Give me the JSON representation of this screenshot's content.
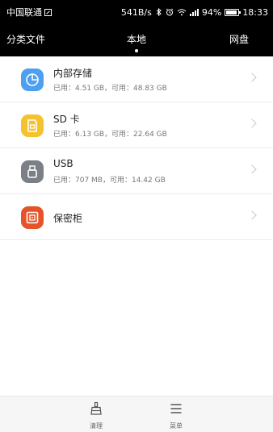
{
  "status_bar": {
    "carrier": "中国联通",
    "speed": "541B/s",
    "battery_percent": "94%",
    "time": "18:33"
  },
  "tabs": {
    "left": "分类文件",
    "center": "本地",
    "right": "网盘",
    "active": "本地"
  },
  "storage_items": [
    {
      "title": "内部存储",
      "sub": "已用：4.51 GB，可用：48.83 GB",
      "icon": "pie-chart-icon",
      "color": "#4e9ff0"
    },
    {
      "title": "SD 卡",
      "sub": "已用：6.13 GB，可用：22.64 GB",
      "icon": "sd-card-icon",
      "color": "#f5c22f"
    },
    {
      "title": "USB",
      "sub": "已用：707 MB，可用：14.42 GB",
      "icon": "usb-icon",
      "color": "#7b7f86"
    },
    {
      "title": "保密柜",
      "sub": "",
      "icon": "safe-icon",
      "color": "#e6532a"
    }
  ],
  "bottom_bar": {
    "clean_label": "清理",
    "menu_label": "菜单"
  }
}
